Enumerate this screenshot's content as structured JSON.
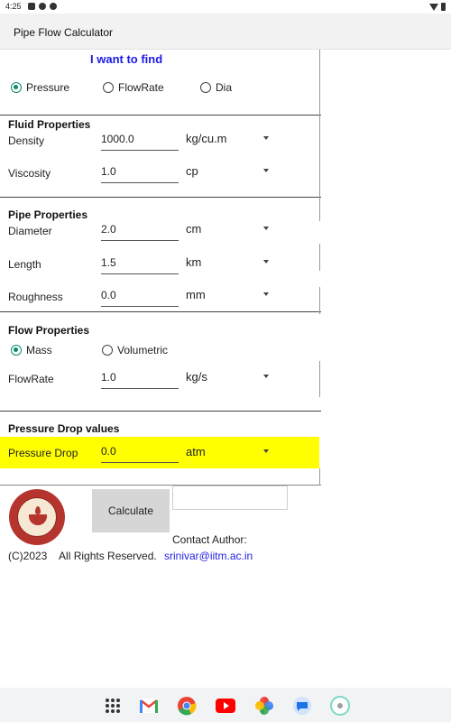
{
  "status_bar": {
    "time": "4:25"
  },
  "app_bar": {
    "title": "Pipe Flow Calculator"
  },
  "find": {
    "title": "I want to find",
    "options": [
      "Pressure",
      "FlowRate",
      "Dia"
    ],
    "selected": "Pressure"
  },
  "fluid": {
    "title": "Fluid Properties",
    "density": {
      "label": "Density",
      "value": "1000.0",
      "unit": "kg/cu.m"
    },
    "viscosity": {
      "label": "Viscosity",
      "value": "1.0",
      "unit": "cp"
    }
  },
  "pipe": {
    "title": "Pipe Properties",
    "diameter": {
      "label": "Diameter",
      "value": "2.0",
      "unit": "cm"
    },
    "length": {
      "label": "Length",
      "value": "1.5",
      "unit": "km"
    },
    "roughness": {
      "label": "Roughness",
      "value": "0.0",
      "unit": "mm"
    }
  },
  "flow": {
    "title": "Flow Properties",
    "options": [
      "Mass",
      "Volumetric"
    ],
    "selected": "Mass",
    "flowrate": {
      "label": "FlowRate",
      "value": "1.0",
      "unit": "kg/s"
    }
  },
  "pressure": {
    "title": "Pressure Drop values",
    "drop": {
      "label": "Pressure Drop",
      "value": "0.0",
      "unit": "atm"
    },
    "highlight_color": "#ffff00"
  },
  "footer": {
    "calculate_label": "Calculate",
    "contact_label": "Contact Author:",
    "copyright": "(C)2023    All Rights Reserved.",
    "email": "srinivar@iitm.ac.in"
  },
  "colors": {
    "accent": "#0b8a6e",
    "heading_blue": "#1a1ae6",
    "link": "#2323e0"
  },
  "dock_icons": [
    "app-drawer-icon",
    "gmail-icon",
    "chrome-icon",
    "youtube-icon",
    "photos-icon",
    "messages-icon",
    "app-icon"
  ]
}
